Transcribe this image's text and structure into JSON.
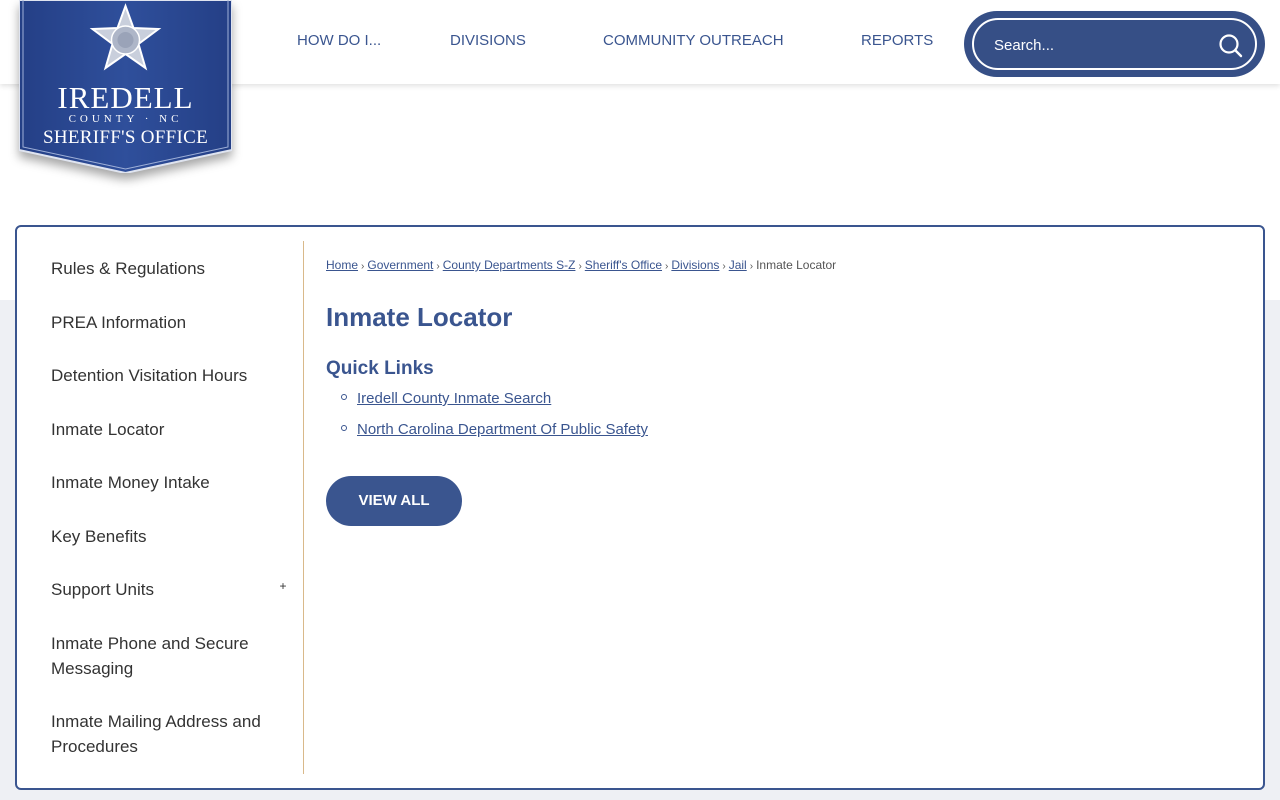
{
  "logo": {
    "line1": "IREDELL",
    "line2": "COUNTY · NC",
    "line3": "SHERIFF'S OFFICE",
    "badge_text": "SHERIFF"
  },
  "nav": {
    "items": [
      {
        "label": "HOW DO I..."
      },
      {
        "label": "DIVISIONS"
      },
      {
        "label": "COMMUNITY OUTREACH"
      },
      {
        "label": "REPORTS"
      }
    ]
  },
  "search": {
    "placeholder": "Search...",
    "icon": "search-icon"
  },
  "sidebar": {
    "items": [
      {
        "label": "Rules & Regulations"
      },
      {
        "label": "PREA Information"
      },
      {
        "label": "Detention Visitation Hours"
      },
      {
        "label": "Inmate Locator"
      },
      {
        "label": "Inmate Money Intake"
      },
      {
        "label": "Key Benefits"
      },
      {
        "label": "Support Units",
        "toggle": "+"
      },
      {
        "label": "Inmate Phone and Secure Messaging"
      },
      {
        "label": "Inmate Mailing Address and Procedures"
      }
    ]
  },
  "breadcrumb": {
    "links": [
      "Home",
      "Government",
      "County Departments S-Z",
      "Sheriff's Office",
      "Divisions",
      "Jail"
    ],
    "current": "Inmate Locator",
    "separator": "›"
  },
  "main": {
    "title": "Inmate Locator",
    "quick_links_title": "Quick Links",
    "quick_links": [
      "Iredell County Inmate Search",
      "North Carolina Department Of Public Safety"
    ],
    "view_all_label": "VIEW ALL"
  },
  "colors": {
    "brand_blue": "#3a558f",
    "search_blue": "#364f86",
    "divider_tan": "#d9b98a",
    "band_gray": "#eef0f4"
  }
}
